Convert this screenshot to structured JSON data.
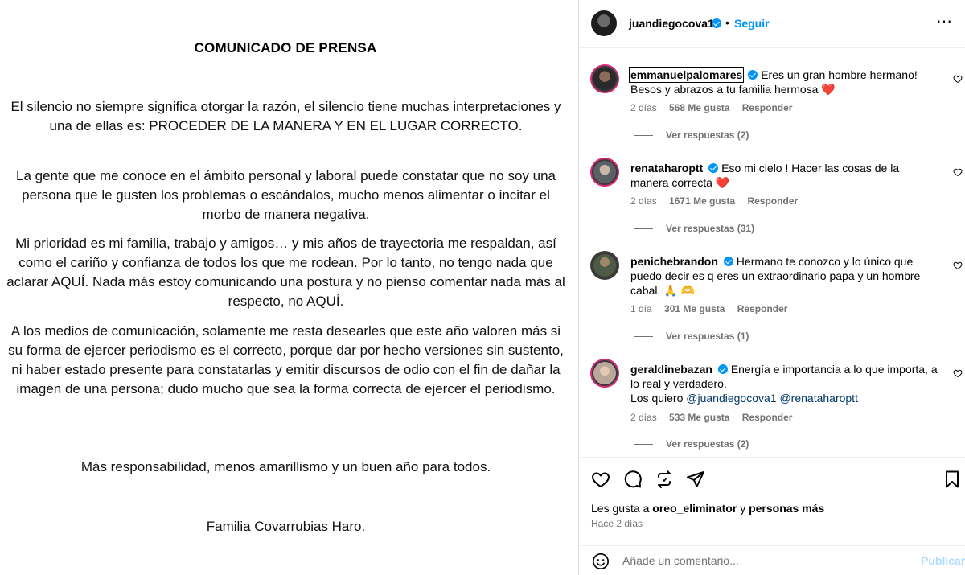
{
  "post_image": {
    "title": "COMUNICADO DE PRENSA",
    "paragraphs": [
      "El silencio no siempre significa otorgar la razón, el silencio tiene muchas interpretaciones y una de ellas es: PROCEDER DE LA MANERA Y EN EL LUGAR CORRECTO.",
      "La gente que me conoce en el ámbito personal y laboral puede constatar que no soy una persona que le gusten los problemas o escándalos, mucho menos alimentar o incitar el morbo de manera negativa.",
      "Mi prioridad es mi familia, trabajo y amigos… y mis años de trayectoria me respaldan, así como el cariño y confianza de todos los que me rodean. Por lo tanto, no tengo nada que aclarar AQUÍ. Nada más estoy comunicando una postura y no pienso comentar nada más al respecto, no AQUÍ.",
      "A los medios de comunicación, solamente me resta desearles que este año valoren más si su forma de ejercer periodismo es el correcto, porque dar por hecho versiones sin sustento, ni haber estado presente para constatarlas y emitir discursos de odio con el fin de dañar la imagen de una persona; dudo mucho que sea la forma correcta de ejercer el periodismo.",
      "Más responsabilidad, menos amarillismo y un buen año para todos.",
      "Familia Covarrubias Haro."
    ]
  },
  "header": {
    "username": "juandiegocova1",
    "separator": "•",
    "follow_label": "Seguir",
    "more_icon": "more-options-icon"
  },
  "comments": [
    {
      "username": "emmanuelpalomares",
      "text": "Eres un gran hombre hermano! Besos y abrazos a tu familia hermosa",
      "emoji": "❤️",
      "time": "2 días",
      "likes": "568 Me gusta",
      "reply": "Responder",
      "replies": "Ver respuestas (2)"
    },
    {
      "username": "renataharoptt",
      "text": "Eso mi cielo ! Hacer las cosas de la manera correcta",
      "emoji": "❤️",
      "time": "2 días",
      "likes": "1671 Me gusta",
      "reply": "Responder",
      "replies": "Ver respuestas (31)"
    },
    {
      "username": "penichebrandon",
      "text": "Hermano te conozco y lo único que puedo decir es q eres un extraordinario papa y un hombre cabal.",
      "emoji": "🙏 🫶",
      "time": "1 día",
      "likes": "301 Me gusta",
      "reply": "Responder",
      "replies": "Ver respuestas (1)"
    },
    {
      "username": "geraldinebazan",
      "text": "Energía e importancia a lo que importa, a lo real y verdadero.",
      "line2": "Los quiero",
      "mention1": "@juandiegocova1",
      "mention2": "@renataharoptt",
      "time": "2 días",
      "likes": "533 Me gusta",
      "reply": "Responder",
      "replies": "Ver respuestas (2)"
    }
  ],
  "likes_line": {
    "prefix": "Les gusta a",
    "user": "oreo_eliminator",
    "joiner": "y",
    "others": "personas más"
  },
  "time_ago": "Hace 2 días",
  "comment_box": {
    "placeholder": "Añade un comentario...",
    "publish_label": "Publicar"
  }
}
